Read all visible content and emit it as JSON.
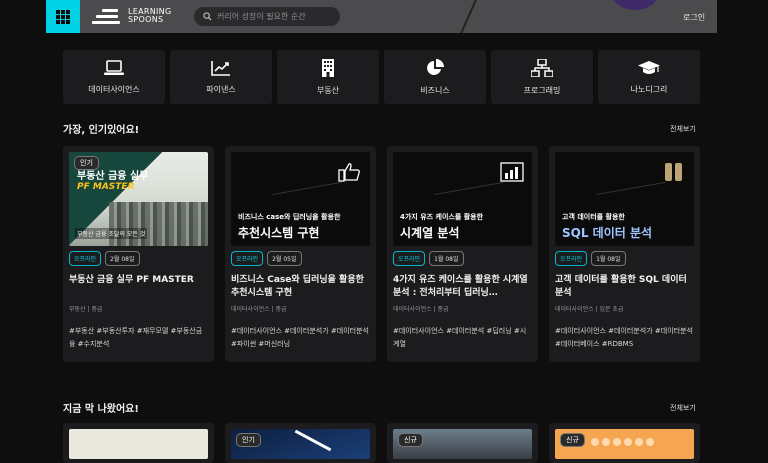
{
  "header": {
    "logo_line1": "LEARNING",
    "logo_line2": "SPOONS",
    "search_placeholder": "커리어 성장이 필요한 순간",
    "login": "로그인"
  },
  "categories": [
    {
      "label": "데이터사이언스",
      "icon": "laptop-icon"
    },
    {
      "label": "파이낸스",
      "icon": "trend-chart-icon"
    },
    {
      "label": "부동산",
      "icon": "building-icon"
    },
    {
      "label": "비즈니스",
      "icon": "pie-chart-icon"
    },
    {
      "label": "프로그래밍",
      "icon": "network-icon"
    },
    {
      "label": "나노디그리",
      "icon": "graduation-cap-icon"
    }
  ],
  "popular": {
    "title": "가장, 인기있어요!",
    "see_all": "전체보기",
    "cards": [
      {
        "hot_tag": "인기",
        "thumb_line1": "부동산 금융 실무",
        "thumb_line2": "PF MASTER",
        "thumb_sub": "부동산 금융 조달의 모든 것",
        "mode": "오프라인",
        "date": "2월 08일",
        "title": "부동산 금융 실무 PF MASTER",
        "meta": "부동산 | 중급",
        "tags": "#부동산 #부동산투자 #재무모델 #부동산금융 #수지분석"
      },
      {
        "thumb_line1": "비즈니스 case와 딥러닝을 활용한",
        "thumb_line2": "추천시스템 구현",
        "mode": "오프라인",
        "date": "2월 05일",
        "title": "비즈니스 Case와 딥러닝을 활용한 추천시스템 구현",
        "meta": "데이터사이언스 | 중급",
        "tags": "#데이터사이언스 #데이터분석가 #데이터분석 #파이썬 #머신러닝"
      },
      {
        "thumb_line1": "4가지 유즈 케이스를 활용한",
        "thumb_line2": "시계열 분석",
        "mode": "오프라인",
        "date": "1월 08일",
        "title": "4가지 유즈 케이스를 활용한 시계열 분석 : 전처리부터 딥러닝…",
        "meta": "데이터사이언스 | 중급",
        "tags": "#데이터사이언스 #데이터분석 #딥러닝 #시계열"
      },
      {
        "thumb_line1": "고객 데이터를 활용한",
        "thumb_line2": "SQL 데이터 분석",
        "mode": "오프라인",
        "date": "1월 08일",
        "title": "고객 데이터를 활용한 SQL 데이터 분석",
        "meta": "데이터사이언스 | 입문 초급",
        "tags": "#데이터사이언스 #데이터분석가 #데이터분석 #데이터베이스 #RDBMS"
      }
    ]
  },
  "new_section": {
    "title": "지금 막 나왔어요!",
    "see_all": "전체보기",
    "tags": [
      "",
      "인기",
      "신규",
      "신규"
    ]
  },
  "colors": {
    "accent": "#00d2e6",
    "background": "#0e0e0f",
    "card": "#1c1c1f",
    "yellow": "#ffc21a"
  }
}
